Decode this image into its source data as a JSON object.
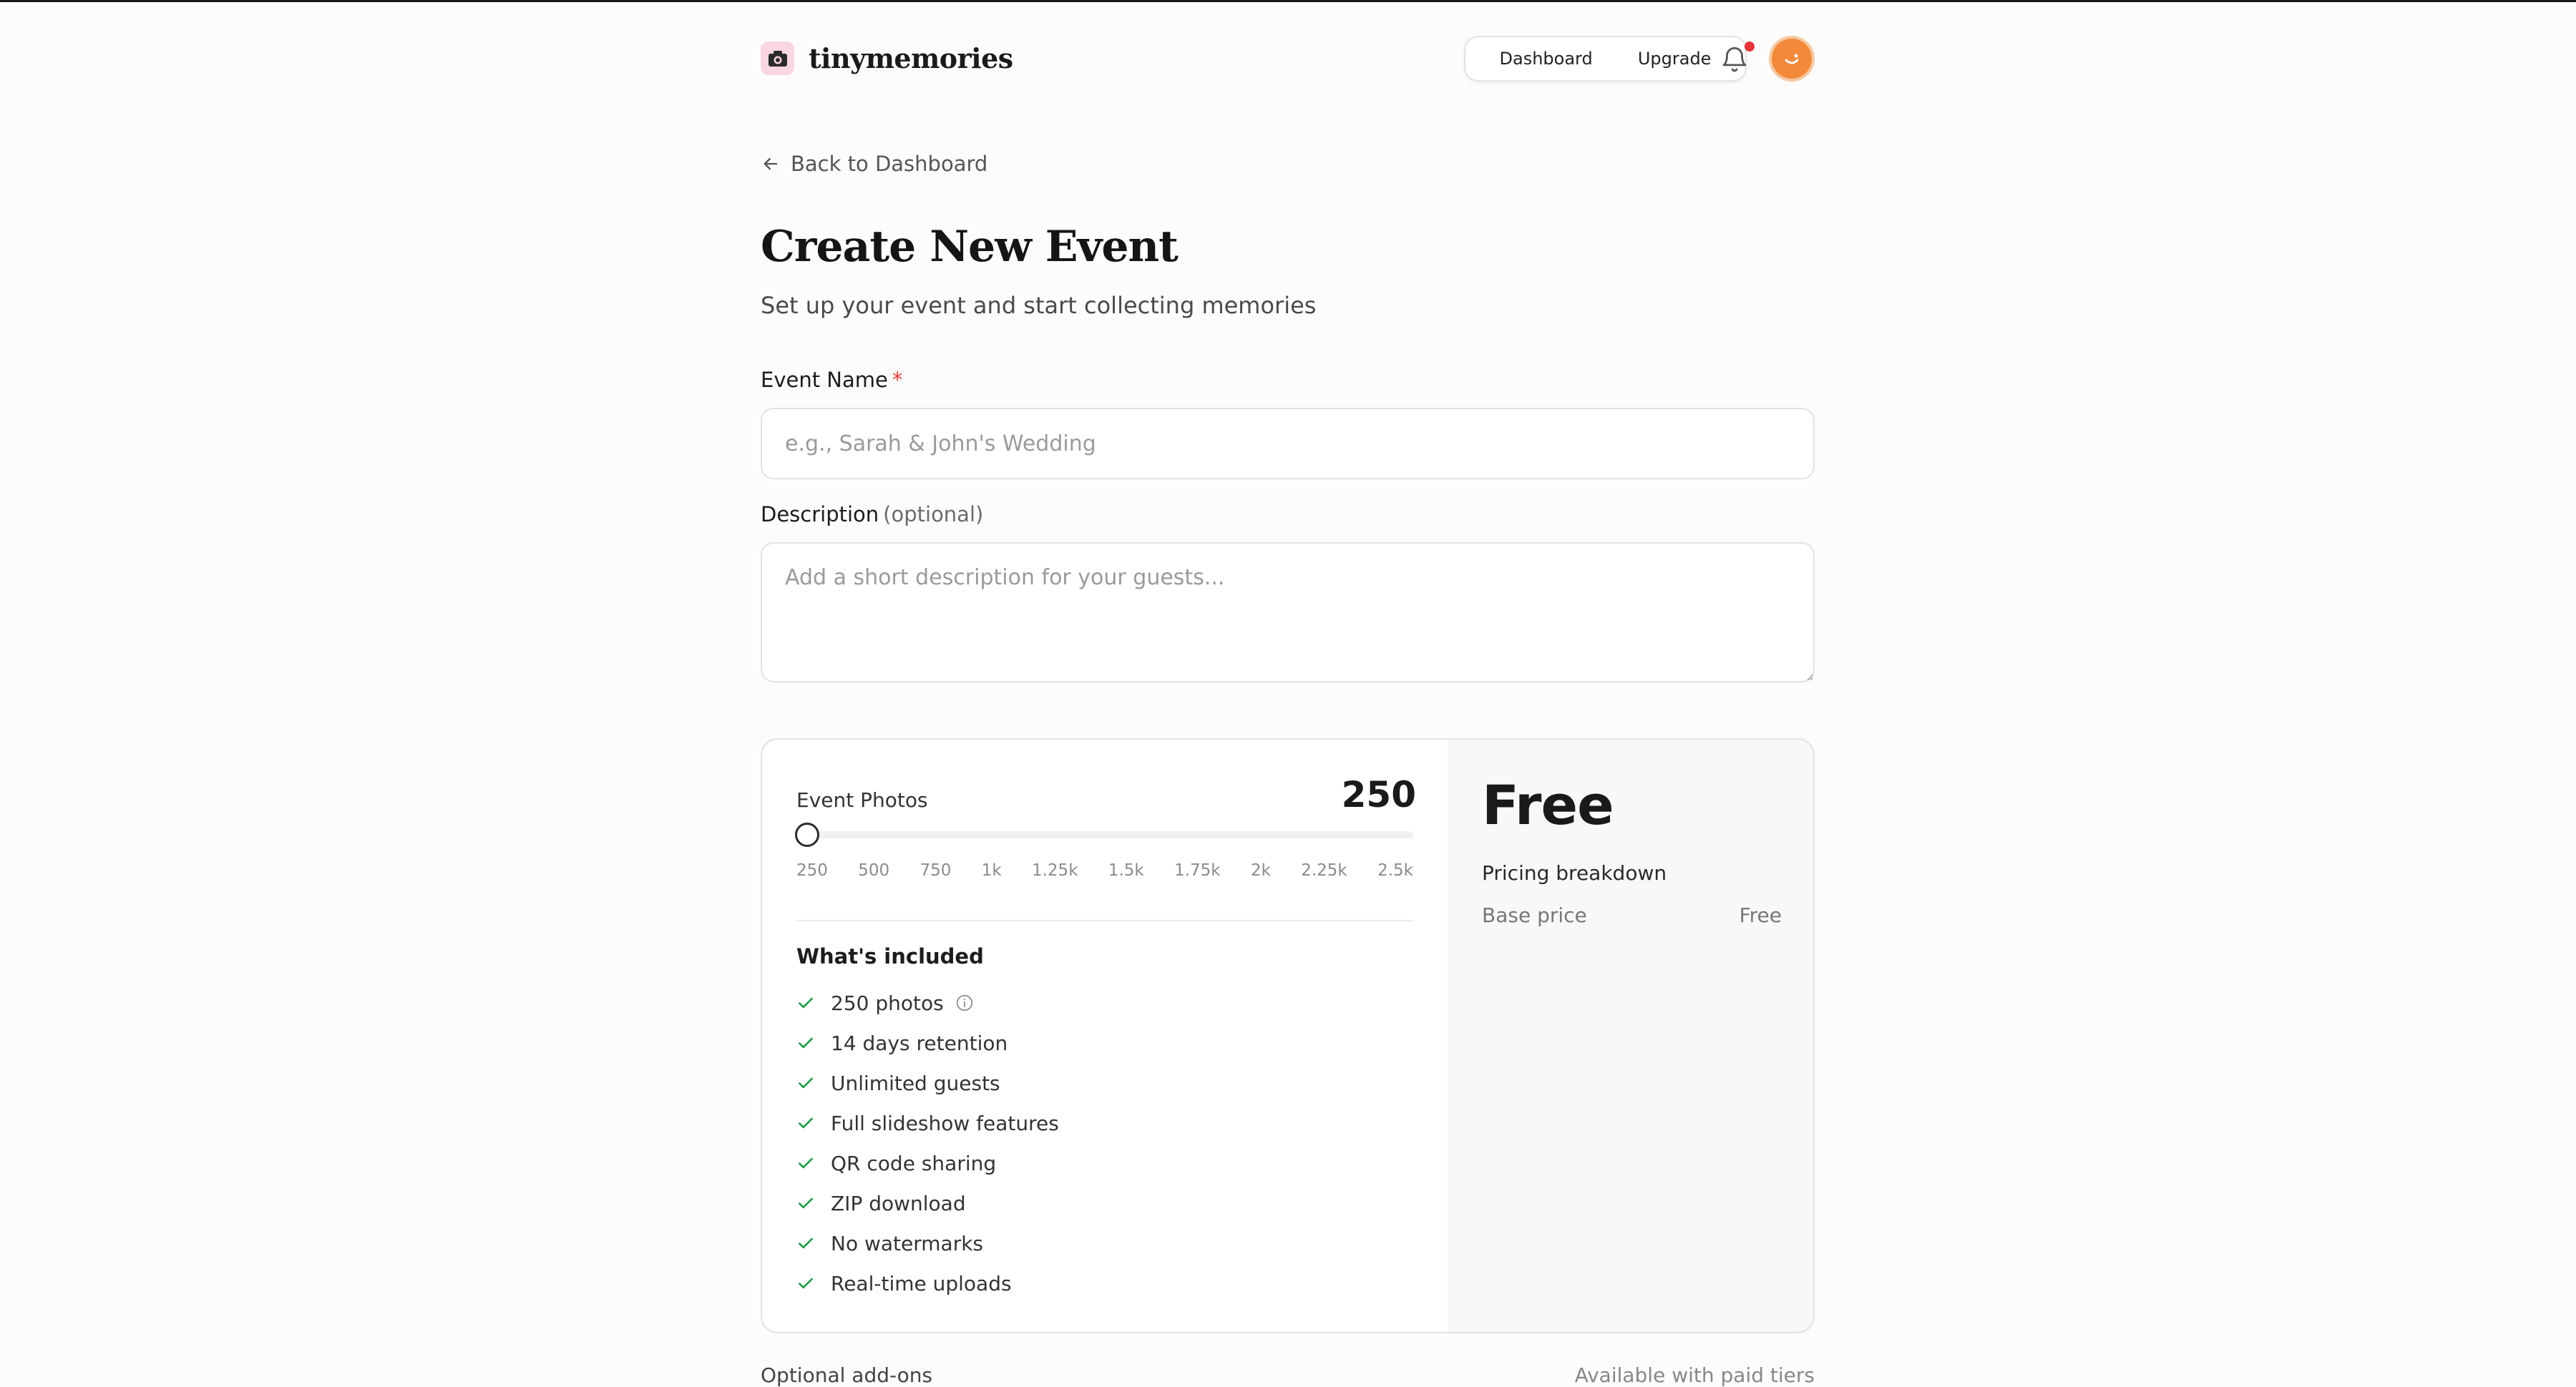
{
  "brand": {
    "name": "tinymemories"
  },
  "nav": {
    "dashboard": "Dashboard",
    "upgrade": "Upgrade"
  },
  "back": {
    "label": "Back to Dashboard"
  },
  "page": {
    "title": "Create New Event",
    "subtitle": "Set up your event and start collecting memories"
  },
  "form": {
    "event_name": {
      "label": "Event Name",
      "required_mark": "*",
      "placeholder": "e.g., Sarah & John's Wedding",
      "value": ""
    },
    "description": {
      "label": "Description",
      "optional": "(optional)",
      "placeholder": "Add a short description for your guests...",
      "value": ""
    }
  },
  "plan": {
    "photos_label": "Event Photos",
    "photos_value": "250",
    "slider": {
      "min": 250,
      "max": 2500,
      "value": 250,
      "step": 250
    },
    "ticks": [
      "250",
      "500",
      "750",
      "1k",
      "1.25k",
      "1.5k",
      "1.75k",
      "2k",
      "2.25k",
      "2.5k"
    ],
    "included_title": "What's included",
    "included": [
      "250 photos",
      "14 days retention",
      "Unlimited guests",
      "Full slideshow features",
      "QR code sharing",
      "ZIP download",
      "No watermarks",
      "Real-time uploads"
    ],
    "price": "Free",
    "breakdown_title": "Pricing breakdown",
    "breakdown": [
      {
        "label": "Base price",
        "value": "Free"
      }
    ]
  },
  "addons": {
    "title": "Optional add-ons",
    "note": "Available with paid tiers"
  },
  "colors": {
    "accent_check": "#1f9d4c",
    "notification_dot": "#e8343b",
    "avatar": "#f28a3a",
    "logo_bg": "#f9d6e0"
  },
  "icons": {
    "logo": "camera-icon",
    "bell": "bell-icon",
    "back": "arrow-left-icon",
    "check": "check-icon",
    "info": "info-icon"
  }
}
